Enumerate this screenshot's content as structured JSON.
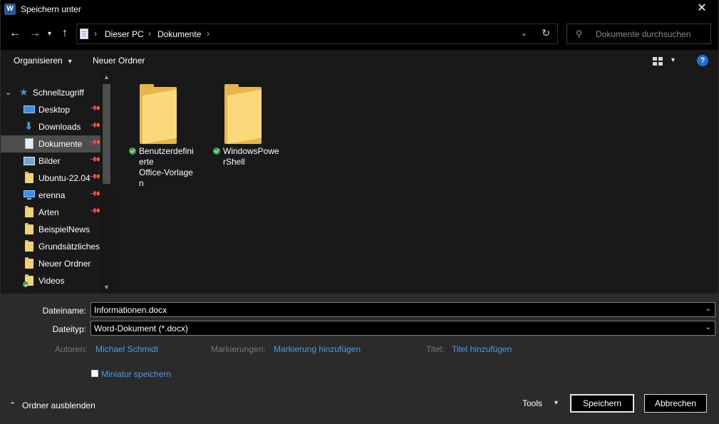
{
  "window": {
    "title": "Speichern unter",
    "app_icon": "word-icon",
    "close_symbol": "✕"
  },
  "nav": {
    "back_symbol": "←",
    "forward_symbol": "→",
    "recent_symbol": "▾",
    "up_symbol": "↑",
    "breadcrumbs": [
      "Dieser PC",
      "Dokumente"
    ],
    "separator": "›",
    "dropdown_symbol": "⌄",
    "refresh_symbol": "↻",
    "search_placeholder": "Dokumente durchsuchen"
  },
  "toolbar": {
    "organize_label": "Organisieren",
    "caret": "▼",
    "new_folder_label": "Neuer Ordner",
    "help_label": "?"
  },
  "sidebar": {
    "quick_access_label": "Schnellzugriff",
    "items": [
      {
        "label": "Desktop",
        "icon": "desktop-icon",
        "pinned": true
      },
      {
        "label": "Downloads",
        "icon": "download-icon",
        "pinned": true
      },
      {
        "label": "Dokumente",
        "icon": "document-icon",
        "pinned": true,
        "selected": true
      },
      {
        "label": "Bilder",
        "icon": "pictures-icon",
        "pinned": true
      },
      {
        "label": "Ubuntu-22.04",
        "icon": "folder-icon",
        "pinned": true
      },
      {
        "label": "erenna",
        "icon": "monitor-icon",
        "pinned": true
      },
      {
        "label": "Arten",
        "icon": "folder-icon",
        "pinned": true
      },
      {
        "label": "BeispielNews",
        "icon": "folder-icon",
        "pinned": false
      },
      {
        "label": "Grundsätzliches",
        "icon": "folder-icon",
        "pinned": false
      },
      {
        "label": "Neuer Ordner",
        "icon": "folder-icon",
        "pinned": false
      },
      {
        "label": "Videos",
        "icon": "folder-synced-icon",
        "pinned": false
      }
    ]
  },
  "content": {
    "folders": [
      {
        "name_lines": [
          "Benutzerdefini",
          "erte",
          "Office-Vorlage",
          "n"
        ],
        "status": "synced"
      },
      {
        "name_lines": [
          "WindowsPowe",
          "rShell"
        ],
        "status": "synced"
      }
    ]
  },
  "form": {
    "filename_label": "Dateiname:",
    "filename_value": "Informationen.docx",
    "filetype_label": "Dateityp:",
    "filetype_value": "Word-Dokument (*.docx)",
    "chevron": "⌄",
    "authors_label": "Autoren:",
    "authors_value": "Michael Schmidt",
    "tags_label": "Markierungen:",
    "tags_value": "Markierung hinzufügen",
    "title_label": "Titel:",
    "title_value": "Titel hinzufügen",
    "thumbnail_label": "Miniatur speichern",
    "thumbnail_checked": false
  },
  "footer": {
    "hide_folders_label": "Ordner ausblenden",
    "hide_caret": "⌃",
    "tools_label": "Tools",
    "tools_caret": "▼",
    "save_label": "Speichern",
    "cancel_label": "Abbrechen"
  },
  "colors": {
    "background": "#191919",
    "titlebar": "#000000",
    "bottom_panel": "#2b2b2b",
    "link": "#4a9be8",
    "folder": "#fbd879",
    "selection": "#4d4d4d"
  }
}
